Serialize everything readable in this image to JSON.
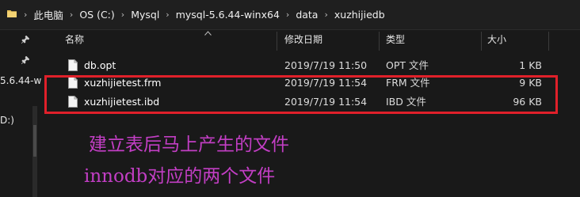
{
  "breadcrumb": [
    "此电脑",
    "OS (C:)",
    "Mysql",
    "mysql-5.6.44-winx64",
    "data",
    "xuzhijiedb"
  ],
  "nav": {
    "fragment_1": "5.6.44-w",
    "fragment_2": "D:)"
  },
  "columns": {
    "name": "名称",
    "date": "修改日期",
    "type": "类型",
    "size": "大小"
  },
  "files": [
    {
      "name": "db.opt",
      "modified": "2019/7/19 11:50",
      "type": "OPT 文件",
      "size": "1 KB"
    },
    {
      "name": "xuzhijietest.frm",
      "modified": "2019/7/19 11:54",
      "type": "FRM 文件",
      "size": "9 KB"
    },
    {
      "name": "xuzhijietest.ibd",
      "modified": "2019/7/19 11:54",
      "type": "IBD 文件",
      "size": "96 KB"
    }
  ],
  "annotations": {
    "line1": "建立表后马上产生的文件",
    "line2": "innodb对应的两个文件"
  },
  "colors": {
    "background": "#191919",
    "highlight_box": "#e0202a",
    "annotation_text": "#c23ec4"
  }
}
